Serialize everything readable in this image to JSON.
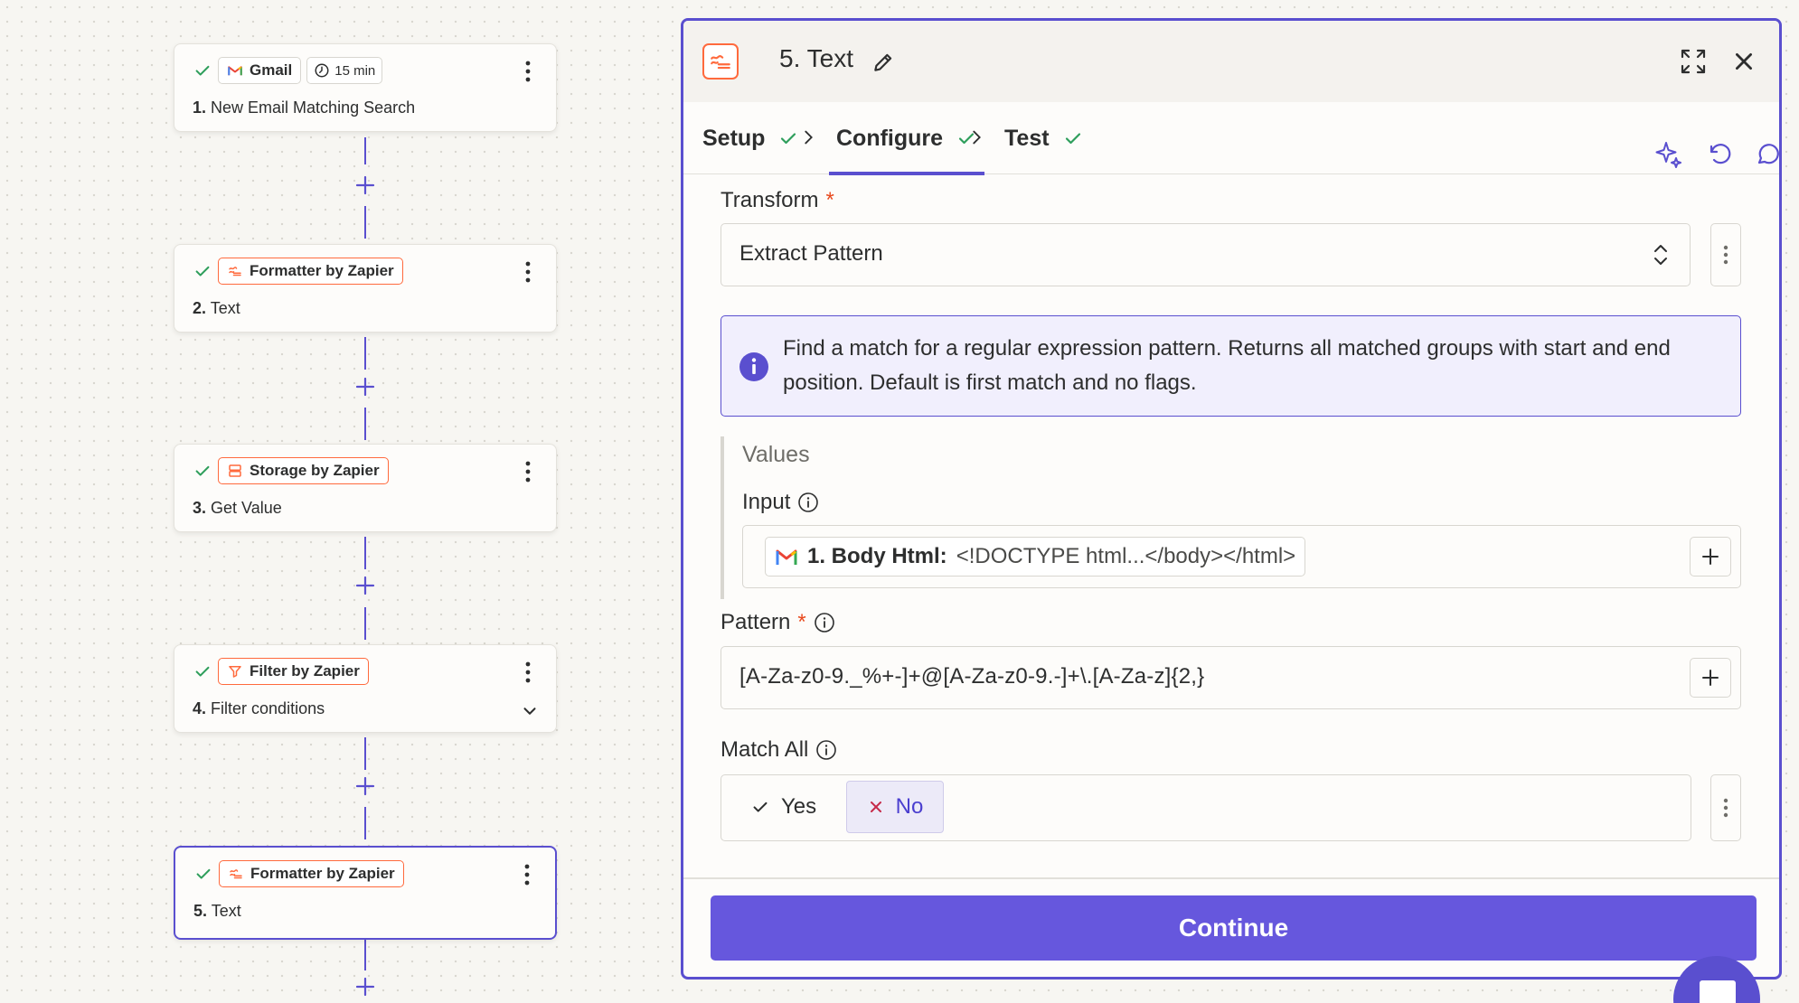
{
  "colors": {
    "accent": "#5a4fcf",
    "brand_orange": "#ff6a3d",
    "success": "#2e9e5b",
    "continue_bg": "#6657dd"
  },
  "workflow": {
    "steps": [
      {
        "app": "Gmail",
        "app_icon": "gmail-icon",
        "badge": "15 min",
        "number": "1.",
        "title": "New Email Matching Search"
      },
      {
        "app": "Formatter by Zapier",
        "app_icon": "formatter-icon",
        "number": "2.",
        "title": "Text"
      },
      {
        "app": "Storage by Zapier",
        "app_icon": "storage-icon",
        "number": "3.",
        "title": "Get Value"
      },
      {
        "app": "Filter by Zapier",
        "app_icon": "filter-icon",
        "number": "4.",
        "title": "Filter conditions"
      },
      {
        "app": "Formatter by Zapier",
        "app_icon": "formatter-icon",
        "number": "5.",
        "title": "Text"
      }
    ]
  },
  "panel": {
    "title": "5. Text",
    "tabs": [
      {
        "label": "Setup"
      },
      {
        "label": "Configure"
      },
      {
        "label": "Test"
      }
    ],
    "transform": {
      "label": "Transform",
      "required": "*",
      "value": "Extract Pattern"
    },
    "info": "Find a match for a regular expression pattern. Returns all matched groups with start and end position. Default is first match and no flags.",
    "values": {
      "title": "Values",
      "input_label": "Input",
      "input_pill_label": "1. Body Html:",
      "input_pill_value": "<!DOCTYPE html...</body></html>"
    },
    "pattern": {
      "label": "Pattern",
      "required": "*",
      "value": "[A-Za-z0-9._%+-]+@[A-Za-z0-9.-]+\\.[A-Za-z]{2,}"
    },
    "match_all": {
      "label": "Match All",
      "yes": "Yes",
      "no": "No",
      "selected": "No"
    },
    "continue_label": "Continue"
  }
}
